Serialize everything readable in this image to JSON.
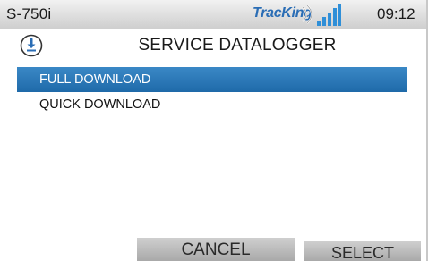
{
  "status_bar": {
    "model": "S-750i",
    "brand": "TracKing",
    "time": "09:12",
    "icons": [
      "wifi-wave-icon",
      "signal-strength-icon"
    ],
    "brand_color": "#2a6db5"
  },
  "header": {
    "icon": "download-icon",
    "title": "SERVICE DATALOGGER"
  },
  "menu": {
    "items": [
      {
        "label": "FULL DOWNLOAD",
        "selected": true
      },
      {
        "label": "QUICK DOWNLOAD",
        "selected": false
      }
    ],
    "selected_color": "#2a78b8"
  },
  "softkeys": {
    "cancel_label": "CANCEL",
    "select_label": "SELECT"
  }
}
